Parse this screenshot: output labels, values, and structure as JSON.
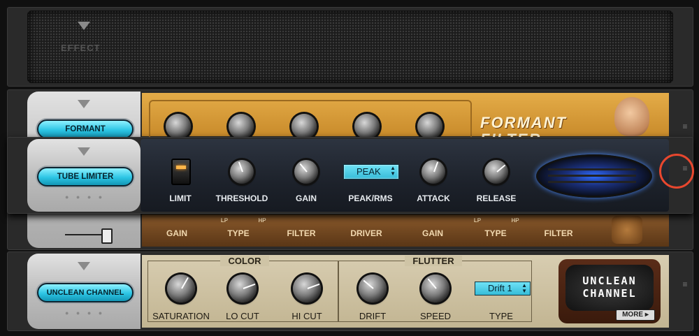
{
  "empty_slot": {
    "label": "EFFECT"
  },
  "formant": {
    "name": "FORMANT",
    "logo_line1": "FORMANT",
    "logo_line2": "FILTER",
    "lower_labels": [
      "GAIN",
      "TYPE",
      "FILTER",
      "DRIVER",
      "GAIN",
      "TYPE",
      "FILTER"
    ],
    "lp": "LP",
    "hp": "HP"
  },
  "tube_limiter": {
    "name": "TUBE LIMITER",
    "labels": {
      "limit": "LIMIT",
      "threshold": "THRESHOLD",
      "gain": "GAIN",
      "peak_rms": "PEAK/RMS",
      "attack": "ATTACK",
      "release": "RELEASE"
    },
    "peak_value": "PEAK",
    "limit_led_on": true
  },
  "unclean": {
    "name": "UNCLEAN CHANNEL",
    "color_title": "COLOR",
    "flutter_title": "FLUTTER",
    "labels": {
      "saturation": "SATURATION",
      "lo_cut": "LO CUT",
      "hi_cut": "HI CUT",
      "drift": "DRIFT",
      "speed": "SPEED",
      "type": "TYPE"
    },
    "type_value": "Drift 1",
    "logo_line1": "UNCLEAN",
    "logo_line2": "CHANNEL",
    "more": "MORE ▸"
  },
  "colors": {
    "accent": "#2cc5e4",
    "highlight": "#e8472e",
    "amber": "#d69a34"
  }
}
